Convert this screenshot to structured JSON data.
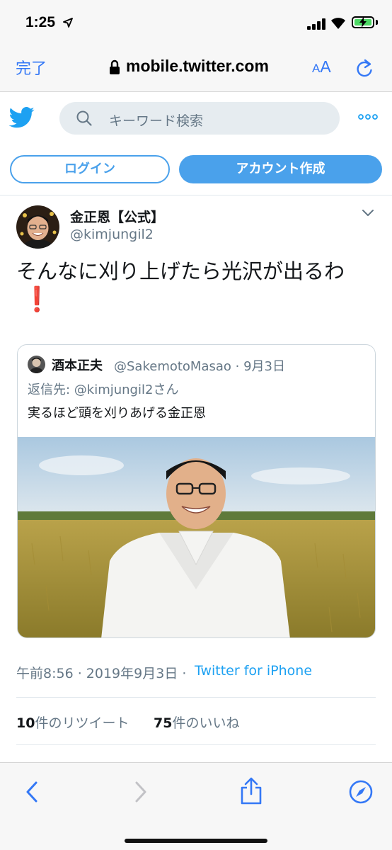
{
  "status_bar": {
    "time": "1:25"
  },
  "safari": {
    "done_label": "完了",
    "url": "mobile.twitter.com",
    "text_size_label_small": "A",
    "text_size_label_big": "A"
  },
  "twitter_header": {
    "search_placeholder": "キーワード検索",
    "brand_color": "#1da1f2"
  },
  "auth": {
    "login_label": "ログイン",
    "signup_label": "アカウント作成"
  },
  "tweet": {
    "author_name": "金正恩【公式】",
    "author_handle": "@kimjungil2",
    "text": "そんなに刈り上げたら光沢が出るわ",
    "emoji": "❗",
    "quoted": {
      "author_name": "酒本正夫",
      "author_meta": "@SakemotoMasao · 9月3日",
      "reply_to": "返信先: @kimjungil2さん",
      "text": "実るほど頭を刈りあげる金正恩"
    },
    "timestamp": "午前8:56 · 2019年9月3日 · ",
    "source": "Twitter for iPhone",
    "retweets_count": "10",
    "retweets_label": "件のリツイート",
    "likes_count": "75",
    "likes_label": "件のいいね"
  },
  "icons": {
    "back": "chevron-left-icon",
    "forward": "chevron-right-icon",
    "share": "share-icon",
    "compass": "compass-icon"
  }
}
